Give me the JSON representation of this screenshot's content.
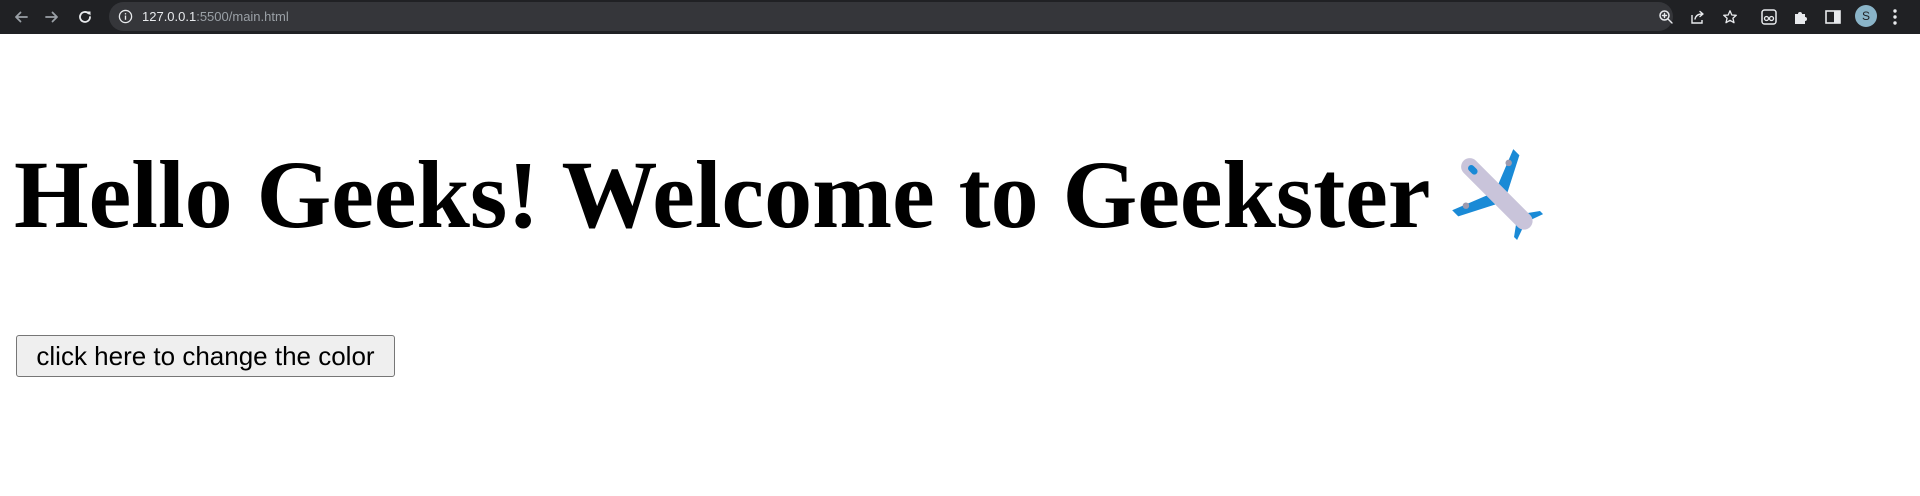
{
  "browser": {
    "url_host": "127.0.0.1",
    "url_path": ":5500/main.html",
    "profile_initial": "S",
    "icons": {
      "back": "arrow-left-icon",
      "forward": "arrow-right-icon",
      "reload": "reload-icon",
      "site_info": "info-icon",
      "zoom": "zoom-icon",
      "share": "share-icon",
      "bookmark": "star-icon",
      "extension": "extension-icon",
      "extensions_menu": "puzzle-icon",
      "side_panel": "side-panel-icon",
      "menu": "kebab-menu-icon"
    }
  },
  "page": {
    "heading": "Hello Geeks! Welcome to Geekster",
    "heading_icon": "airplane-icon",
    "button_label": "click here to change the color"
  },
  "colors": {
    "browser_bar": "#202124",
    "omnibox": "#35363a",
    "page_background": "#ffffff",
    "heading_text": "#000000",
    "airplane_body": "#c9c4da",
    "airplane_wings": "#1a8ad6"
  }
}
